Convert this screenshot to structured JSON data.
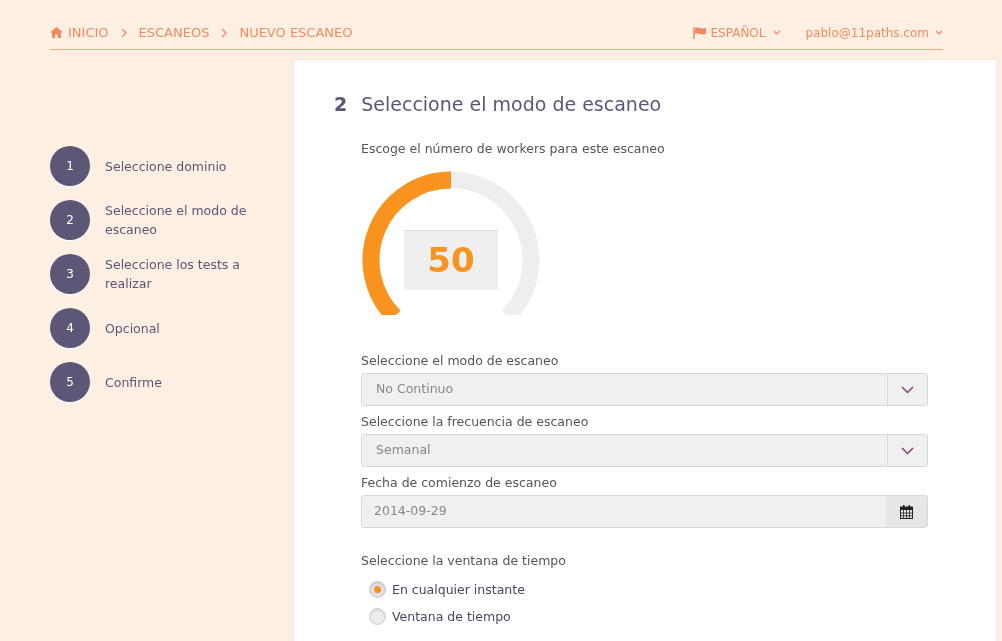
{
  "breadcrumb": [
    "INICIO",
    "ESCANEOS",
    "NUEVO ESCANEO"
  ],
  "language": {
    "label": "ESPAÑOL"
  },
  "user": {
    "label": "pablo@11paths.com"
  },
  "steps": [
    {
      "number": "1",
      "label": "Seleccione dominio"
    },
    {
      "number": "2",
      "label": "Seleccione el modo de escaneo"
    },
    {
      "number": "3",
      "label": "Seleccione los tests a realizar"
    },
    {
      "number": "4",
      "label": "Opcional"
    },
    {
      "number": "5",
      "label": "Confirme"
    }
  ],
  "section": {
    "number": "2",
    "title": "Seleccione el modo de escaneo"
  },
  "workers": {
    "label": "Escoge el número de workers para este escaneo",
    "value": "50",
    "level": 0.5
  },
  "fields": [
    {
      "kind": "select",
      "label": "Seleccione el modo de escaneo",
      "value": "No Continuo"
    },
    {
      "kind": "select",
      "label": "Seleccione la frecuencia de escaneo",
      "value": "Semanal"
    },
    {
      "kind": "date",
      "label": "Fecha de comienzo de escaneo",
      "value": "2014-09-29"
    }
  ],
  "time_window": {
    "label": "Seleccione la ventana de tiempo",
    "options": [
      {
        "label": "En cualquier instante",
        "selected": true
      },
      {
        "label": "Ventana de tiempo",
        "selected": false
      }
    ]
  }
}
